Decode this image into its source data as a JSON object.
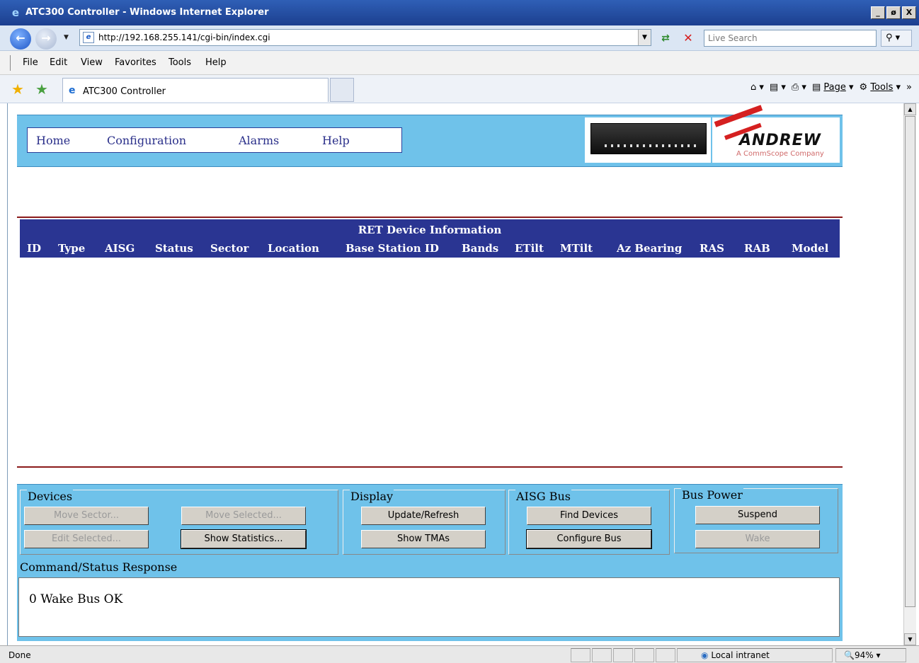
{
  "window": {
    "title": "ATC300 Controller - Windows Internet Explorer",
    "controls": [
      "_",
      "ø",
      "X"
    ]
  },
  "address": {
    "url": "http://192.168.255.141/cgi-bin/index.cgi",
    "search_placeholder": "Live Search"
  },
  "menu": [
    "File",
    "Edit",
    "View",
    "Favorites",
    "Tools",
    "Help"
  ],
  "tab": {
    "label": "ATC300 Controller"
  },
  "command_bar": {
    "page": "Page",
    "tools": "Tools"
  },
  "nav": [
    "Home",
    "Configuration",
    "Alarms",
    "Help"
  ],
  "logo": {
    "name": "ANDREW",
    "tagline": "A CommScope Company"
  },
  "table": {
    "caption": "RET Device Information",
    "columns": [
      "ID",
      "Type",
      "AISG",
      "Status",
      "Sector",
      "Location",
      "Base Station ID",
      "Bands",
      "ETilt",
      "MTilt",
      "Az Bearing",
      "RAS",
      "RAB",
      "Model"
    ]
  },
  "groups": {
    "devices": {
      "label": "Devices",
      "move_sector": "Move Sector...",
      "move_selected": "Move Selected...",
      "edit_selected": "Edit Selected...",
      "show_statistics": "Show Statistics..."
    },
    "display": {
      "label": "Display",
      "update_refresh": "Update/Refresh",
      "show_tmas": "Show TMAs"
    },
    "aisg_bus": {
      "label": "AISG Bus",
      "find_devices": "Find Devices",
      "configure_bus": "Configure Bus"
    },
    "bus_power": {
      "label": "Bus Power",
      "suspend": "Suspend",
      "wake": "Wake"
    }
  },
  "response": {
    "label": "Command/Status Response",
    "text": "0 Wake Bus OK"
  },
  "status": {
    "done": "Done",
    "zone": "Local intranet",
    "zoom": "94%"
  },
  "colors": {
    "banner": "#6fc2ea",
    "table_header": "#2a3592",
    "rule": "#8b1a1a"
  }
}
